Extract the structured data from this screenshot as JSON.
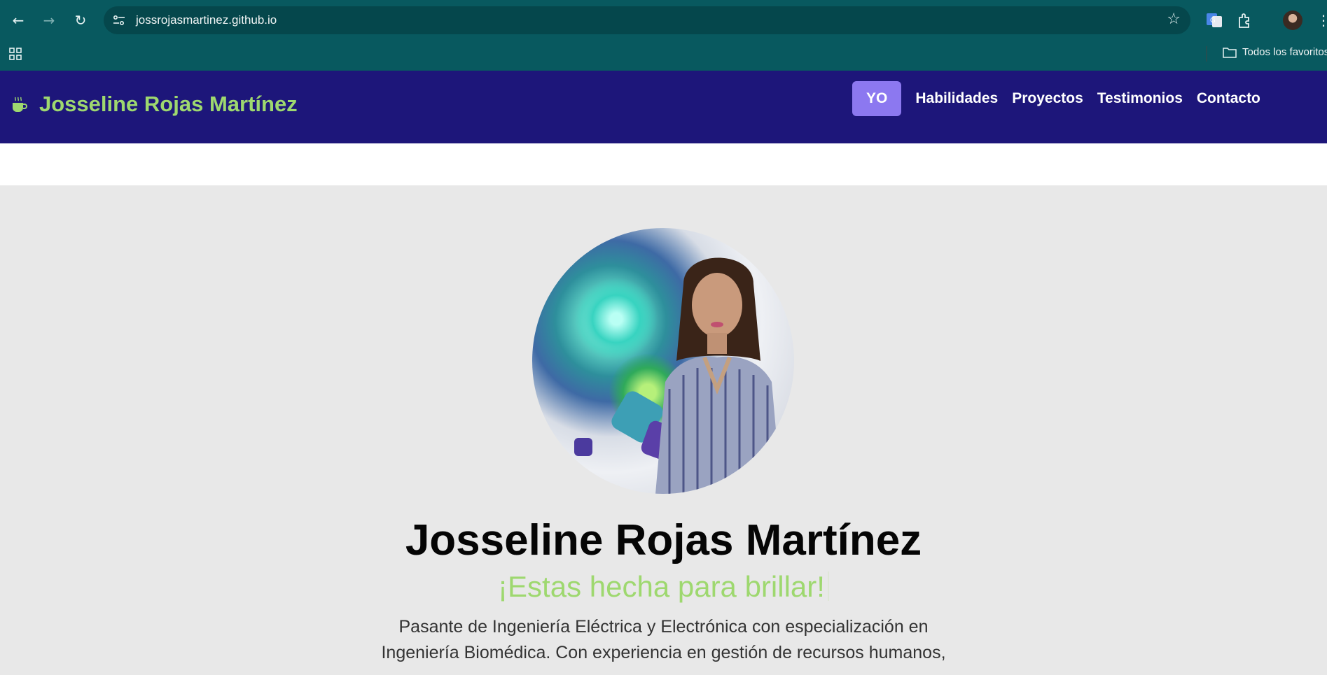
{
  "browser": {
    "url": "jossrojasmartinez.github.io",
    "bookmarks_folder": "Todos los favoritos"
  },
  "site": {
    "brand": "Josseline Rojas Martínez",
    "brand_color": "#9ed86f",
    "header_color": "#1d167a",
    "nav": [
      {
        "label": "YO",
        "active": true
      },
      {
        "label": "Habilidades",
        "active": false
      },
      {
        "label": "Proyectos",
        "active": false
      },
      {
        "label": "Testimonios",
        "active": false
      },
      {
        "label": "Contacto",
        "active": false
      }
    ],
    "active_nav_color": "#8c78f0"
  },
  "hero": {
    "name": "Josseline Rojas Martínez",
    "tagline": "¡Estas hecha para brillar!",
    "description_line1": "Pasante de Ingeniería Eléctrica y Electrónica con especialización en",
    "description_line2": "Ingeniería Biomédica. Con experiencia en gestión de recursos humanos,",
    "photo_alt": "Josseline Rojas Martínez"
  }
}
